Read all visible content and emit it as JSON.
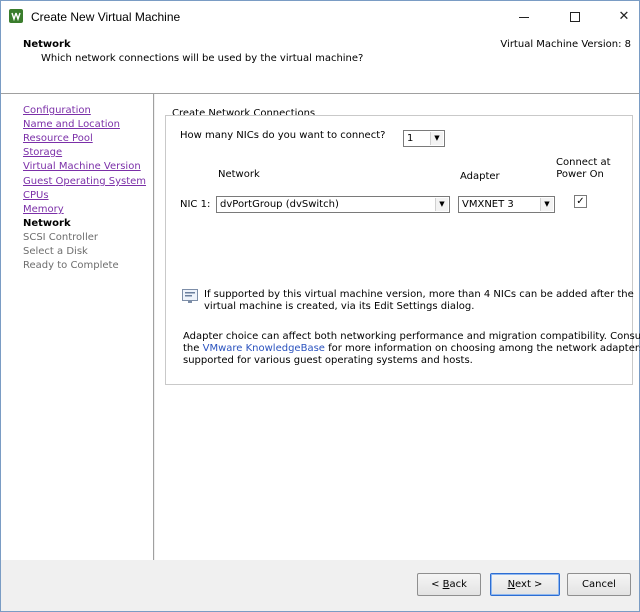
{
  "window": {
    "title": "Create New Virtual Machine",
    "icon": "vsphere-logo-icon",
    "minimize": "minimize-icon",
    "maximize": "maximize-icon",
    "close_glyph": "✕"
  },
  "header": {
    "title": "Network",
    "subtitle": "Which network connections will be used by the virtual machine?",
    "version": "Virtual Machine Version: 8"
  },
  "nav": {
    "items": [
      {
        "label": "Configuration",
        "state": "link"
      },
      {
        "label": "Name and Location",
        "state": "link"
      },
      {
        "label": "Resource Pool",
        "state": "link"
      },
      {
        "label": "Storage",
        "state": "link"
      },
      {
        "label": "Virtual Machine Version",
        "state": "link"
      },
      {
        "label": "Guest Operating System",
        "state": "link"
      },
      {
        "label": "CPUs",
        "state": "link"
      },
      {
        "label": "Memory",
        "state": "link"
      },
      {
        "label": "Network",
        "state": "current"
      },
      {
        "label": "SCSI Controller",
        "state": "disabled"
      },
      {
        "label": "Select a Disk",
        "state": "disabled"
      },
      {
        "label": "Ready to Complete",
        "state": "disabled"
      }
    ]
  },
  "main": {
    "group_title": "Create Network Connections",
    "nic_count_label": "How many NICs do you want to connect?",
    "nic_count_value": "1",
    "col_network": "Network",
    "col_adapter": "Adapter",
    "col_connect_line1": "Connect at",
    "col_connect_line2": "Power On",
    "nic1_label": "NIC 1:",
    "nic1_network": "dvPortGroup (dvSwitch)",
    "nic1_adapter": "VMXNET 3",
    "nic1_connect_checked": true,
    "check_glyph": "✓",
    "dropdown_glyph": "▼",
    "info_line1": "If supported by this virtual machine version, more than 4 NICs can be added after the",
    "info_line2": "virtual machine is created, via its Edit Settings dialog.",
    "adapter_note_line1": "Adapter choice can affect both networking performance and migration compatibility. Consult",
    "adapter_note_the": "the",
    "adapter_note_link": "VMware KnowledgeBase",
    "adapter_note_line2_rest": "for more information on choosing among the network adapters",
    "adapter_note_line3": "supported for various guest operating systems and hosts."
  },
  "footer": {
    "back_prefix": "< ",
    "back_mnemonic": "B",
    "back_rest": "ack",
    "next_mnemonic": "N",
    "next_rest": "ext >",
    "cancel_label": "Cancel"
  },
  "colors": {
    "visited_link": "#7b2fa8",
    "kb_link": "#2a52be",
    "default_button_border": "#2d6dd2"
  }
}
